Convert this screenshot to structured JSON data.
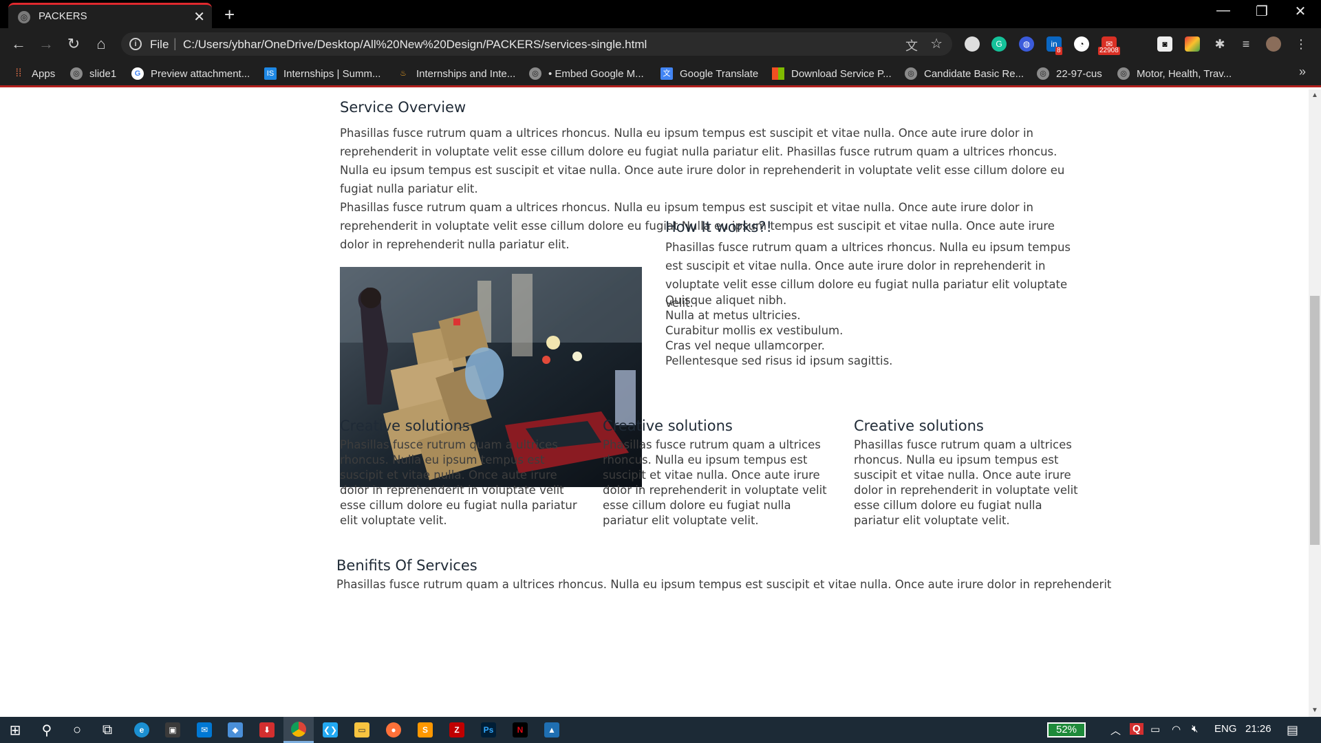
{
  "browser": {
    "tab_title": "PACKERS",
    "url_scheme": "File",
    "url": "C:/Users/ybhar/OneDrive/Desktop/All%20New%20Design/PACKERS/services-single.html",
    "extension_badges": {
      "linkedin": "8",
      "gmail": "22908"
    },
    "bookmarks": [
      {
        "label": "Apps",
        "icon": "apps-grid-icon"
      },
      {
        "label": "slide1",
        "icon": "globe-icon"
      },
      {
        "label": "Preview attachment...",
        "icon": "google-icon"
      },
      {
        "label": "Internships | Summ...",
        "icon": "internshala-icon"
      },
      {
        "label": "Internships and Inte...",
        "icon": "flame-icon"
      },
      {
        "label": "• Embed Google M...",
        "icon": "globe-icon"
      },
      {
        "label": "Google Translate",
        "icon": "translate-icon"
      },
      {
        "label": "Download Service P...",
        "icon": "microsoft-icon"
      },
      {
        "label": "Candidate Basic Re...",
        "icon": "globe-icon"
      },
      {
        "label": "22-97-cus",
        "icon": "globe-icon"
      },
      {
        "label": "Motor, Health, Trav...",
        "icon": "globe-icon"
      }
    ]
  },
  "page": {
    "overview": {
      "heading": "Service Overview",
      "para1": "Phasillas fusce rutrum quam a ultrices rhoncus. Nulla eu ipsum tempus est suscipit et vitae nulla. Once aute irure dolor in reprehenderit in voluptate velit esse cillum dolore eu fugiat nulla pariatur elit. Phasillas fusce rutrum quam a ultrices rhoncus. Nulla eu ipsum tempus est suscipit et vitae nulla. Once aute irure dolor in reprehenderit in voluptate velit esse cillum dolore eu fugiat nulla pariatur elit.",
      "para2": "Phasillas fusce rutrum quam a ultrices rhoncus. Nulla eu ipsum tempus est suscipit et vitae nulla. Once aute irure dolor in reprehenderit in voluptate velit esse cillum dolore eu fugiat Nulla eu ipsum tempus est suscipit et vitae nulla. Once aute irure dolor in reprehenderit nulla pariatur elit."
    },
    "how": {
      "heading": "How It works?!",
      "para": "Phasillas fusce rutrum quam a ultrices rhoncus. Nulla eu ipsum tempus est suscipit et vitae nulla. Once aute irure dolor in reprehenderit in voluptate velit esse cillum dolore eu fugiat nulla pariatur elit voluptate velit.",
      "list": [
        "Quisque aliquet nibh.",
        "Nulla at metus ultricies.",
        "Curabitur mollis ex vestibulum.",
        "Cras vel neque ullamcorper.",
        "Pellentesque sed risus id ipsum sagittis."
      ]
    },
    "columns": [
      {
        "heading": "Creative solutions",
        "text": "Phasillas fusce rutrum quam a ultrices rhoncus. Nulla eu ipsum tempus est suscipit et vitae nulla. Once aute irure dolor in reprehenderit in voluptate velit esse cillum dolore eu fugiat nulla pariatur elit voluptate velit."
      },
      {
        "heading": "Creative solutions",
        "text": "Phasillas fusce rutrum quam a ultrices rhoncus. Nulla eu ipsum tempus est suscipit et vitae nulla. Once aute irure dolor in reprehenderit in voluptate velit esse cillum dolore eu fugiat nulla pariatur elit voluptate velit."
      },
      {
        "heading": "Creative solutions",
        "text": "Phasillas fusce rutrum quam a ultrices rhoncus. Nulla eu ipsum tempus est suscipit et vitae nulla. Once aute irure dolor in reprehenderit in voluptate velit esse cillum dolore eu fugiat nulla pariatur elit voluptate velit."
      }
    ],
    "benefits": {
      "heading": "Benifits Of Services",
      "para": "Phasillas fusce rutrum quam a ultrices rhoncus. Nulla eu ipsum tempus est suscipit et vitae nulla. Once aute irure dolor in reprehenderit"
    }
  },
  "taskbar": {
    "battery": "52%",
    "language": "ENG",
    "time": "21:26"
  },
  "colors": {
    "chrome_dark": "#1f1f1f",
    "tab_accent": "#e0292e",
    "taskbar": "#1c2a36",
    "heading": "#1f2a36",
    "body_text": "#3d3d3d"
  }
}
